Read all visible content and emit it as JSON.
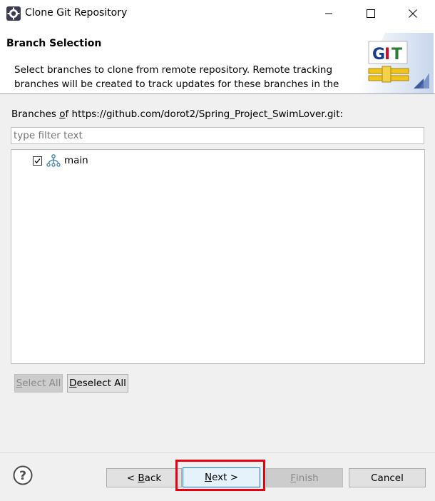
{
  "window": {
    "title": "Clone Git Repository",
    "app_icon": "eclipse-gear-icon",
    "controls": {
      "minimize_icon": "minimize-icon",
      "maximize_icon": "maximize-icon",
      "close_icon": "close-icon"
    }
  },
  "banner": {
    "title": "Branch Selection",
    "description": "Select branches to clone from remote repository. Remote tracking branches will be created to track updates for these branches in the",
    "logo": {
      "letters": [
        "G",
        "I",
        "T"
      ],
      "colors": [
        "#1a3c8f",
        "#c8102e",
        "#2e7d32"
      ]
    }
  },
  "branches": {
    "label_prefix": "Branches ",
    "label_underlined": "o",
    "label_suffix": "f https://github.com/dorot2/Spring_Project_SwimLover.git:",
    "filter_placeholder": "type filter text",
    "items": [
      {
        "name": "main",
        "checked": true,
        "icon": "git-branch-icon"
      }
    ]
  },
  "selection_buttons": {
    "select_all": {
      "underlined": "S",
      "rest": "elect All",
      "enabled": false
    },
    "deselect_all": {
      "underlined": "D",
      "rest": "eselect All",
      "enabled": true
    }
  },
  "footer": {
    "help_icon": "help-icon",
    "back": {
      "prefix": "< ",
      "underlined": "B",
      "rest": "ack",
      "enabled": true
    },
    "next": {
      "underlined": "N",
      "rest": "ext >",
      "enabled": true,
      "highlighted": true,
      "highlight_color": "#e8000f"
    },
    "finish": {
      "underlined": "F",
      "rest": "inish",
      "enabled": false
    },
    "cancel": {
      "label": "Cancel",
      "enabled": true
    }
  }
}
